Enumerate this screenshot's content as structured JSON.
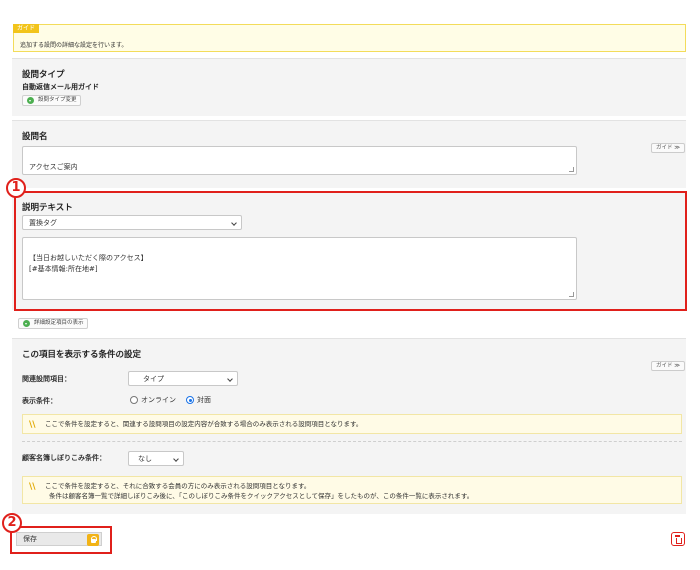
{
  "guide": {
    "tag": "ガイド",
    "text": "追加する設問の詳細な設定を行います。"
  },
  "question_type": {
    "title": "設問タイプ",
    "value": "自動返信メール用ガイド",
    "change_button": "設問タイプ変更"
  },
  "question_name": {
    "title": "設問名",
    "value": "アクセスご案内",
    "guide_button": "ガイド ≫"
  },
  "description": {
    "title": "説明テキスト",
    "select_value": "置換タグ",
    "text": "【当日お越しいただく際のアクセス】\n[#基本情報:所在地#]"
  },
  "detail_toggle": {
    "label": "詳細設定項目の表示"
  },
  "condition": {
    "title": "この項目を表示する条件の設定",
    "guide_button": "ガイド ≫",
    "related_label": "関連設問項目：",
    "related_value": "タイプ",
    "display_label": "表示条件：",
    "option_online": "オンライン",
    "option_inperson": "対面",
    "note1": "ここで条件を設定すると、関連する設問項目の設定内容が合致する場合のみ表示される設問項目となります。",
    "filter_label": "顧客名簿しぼりこみ条件：",
    "filter_value": "なし",
    "note2_line1": "ここで条件を設定すると、それに合致する会員の方にのみ表示される設問項目となります。",
    "note2_line2": "条件は顧客名簿一覧で詳細しぼりこみ後に、「このしぼりこみ条件をクイックアクセスとして保存」をしたものが、この条件一覧に表示されます。"
  },
  "save_button": "保存",
  "badges": {
    "one": "1",
    "two": "2"
  },
  "colors": {
    "accent_red": "#e0201b",
    "guide_yellow": "#f2c41b",
    "lock_orange": "#f2b316"
  }
}
